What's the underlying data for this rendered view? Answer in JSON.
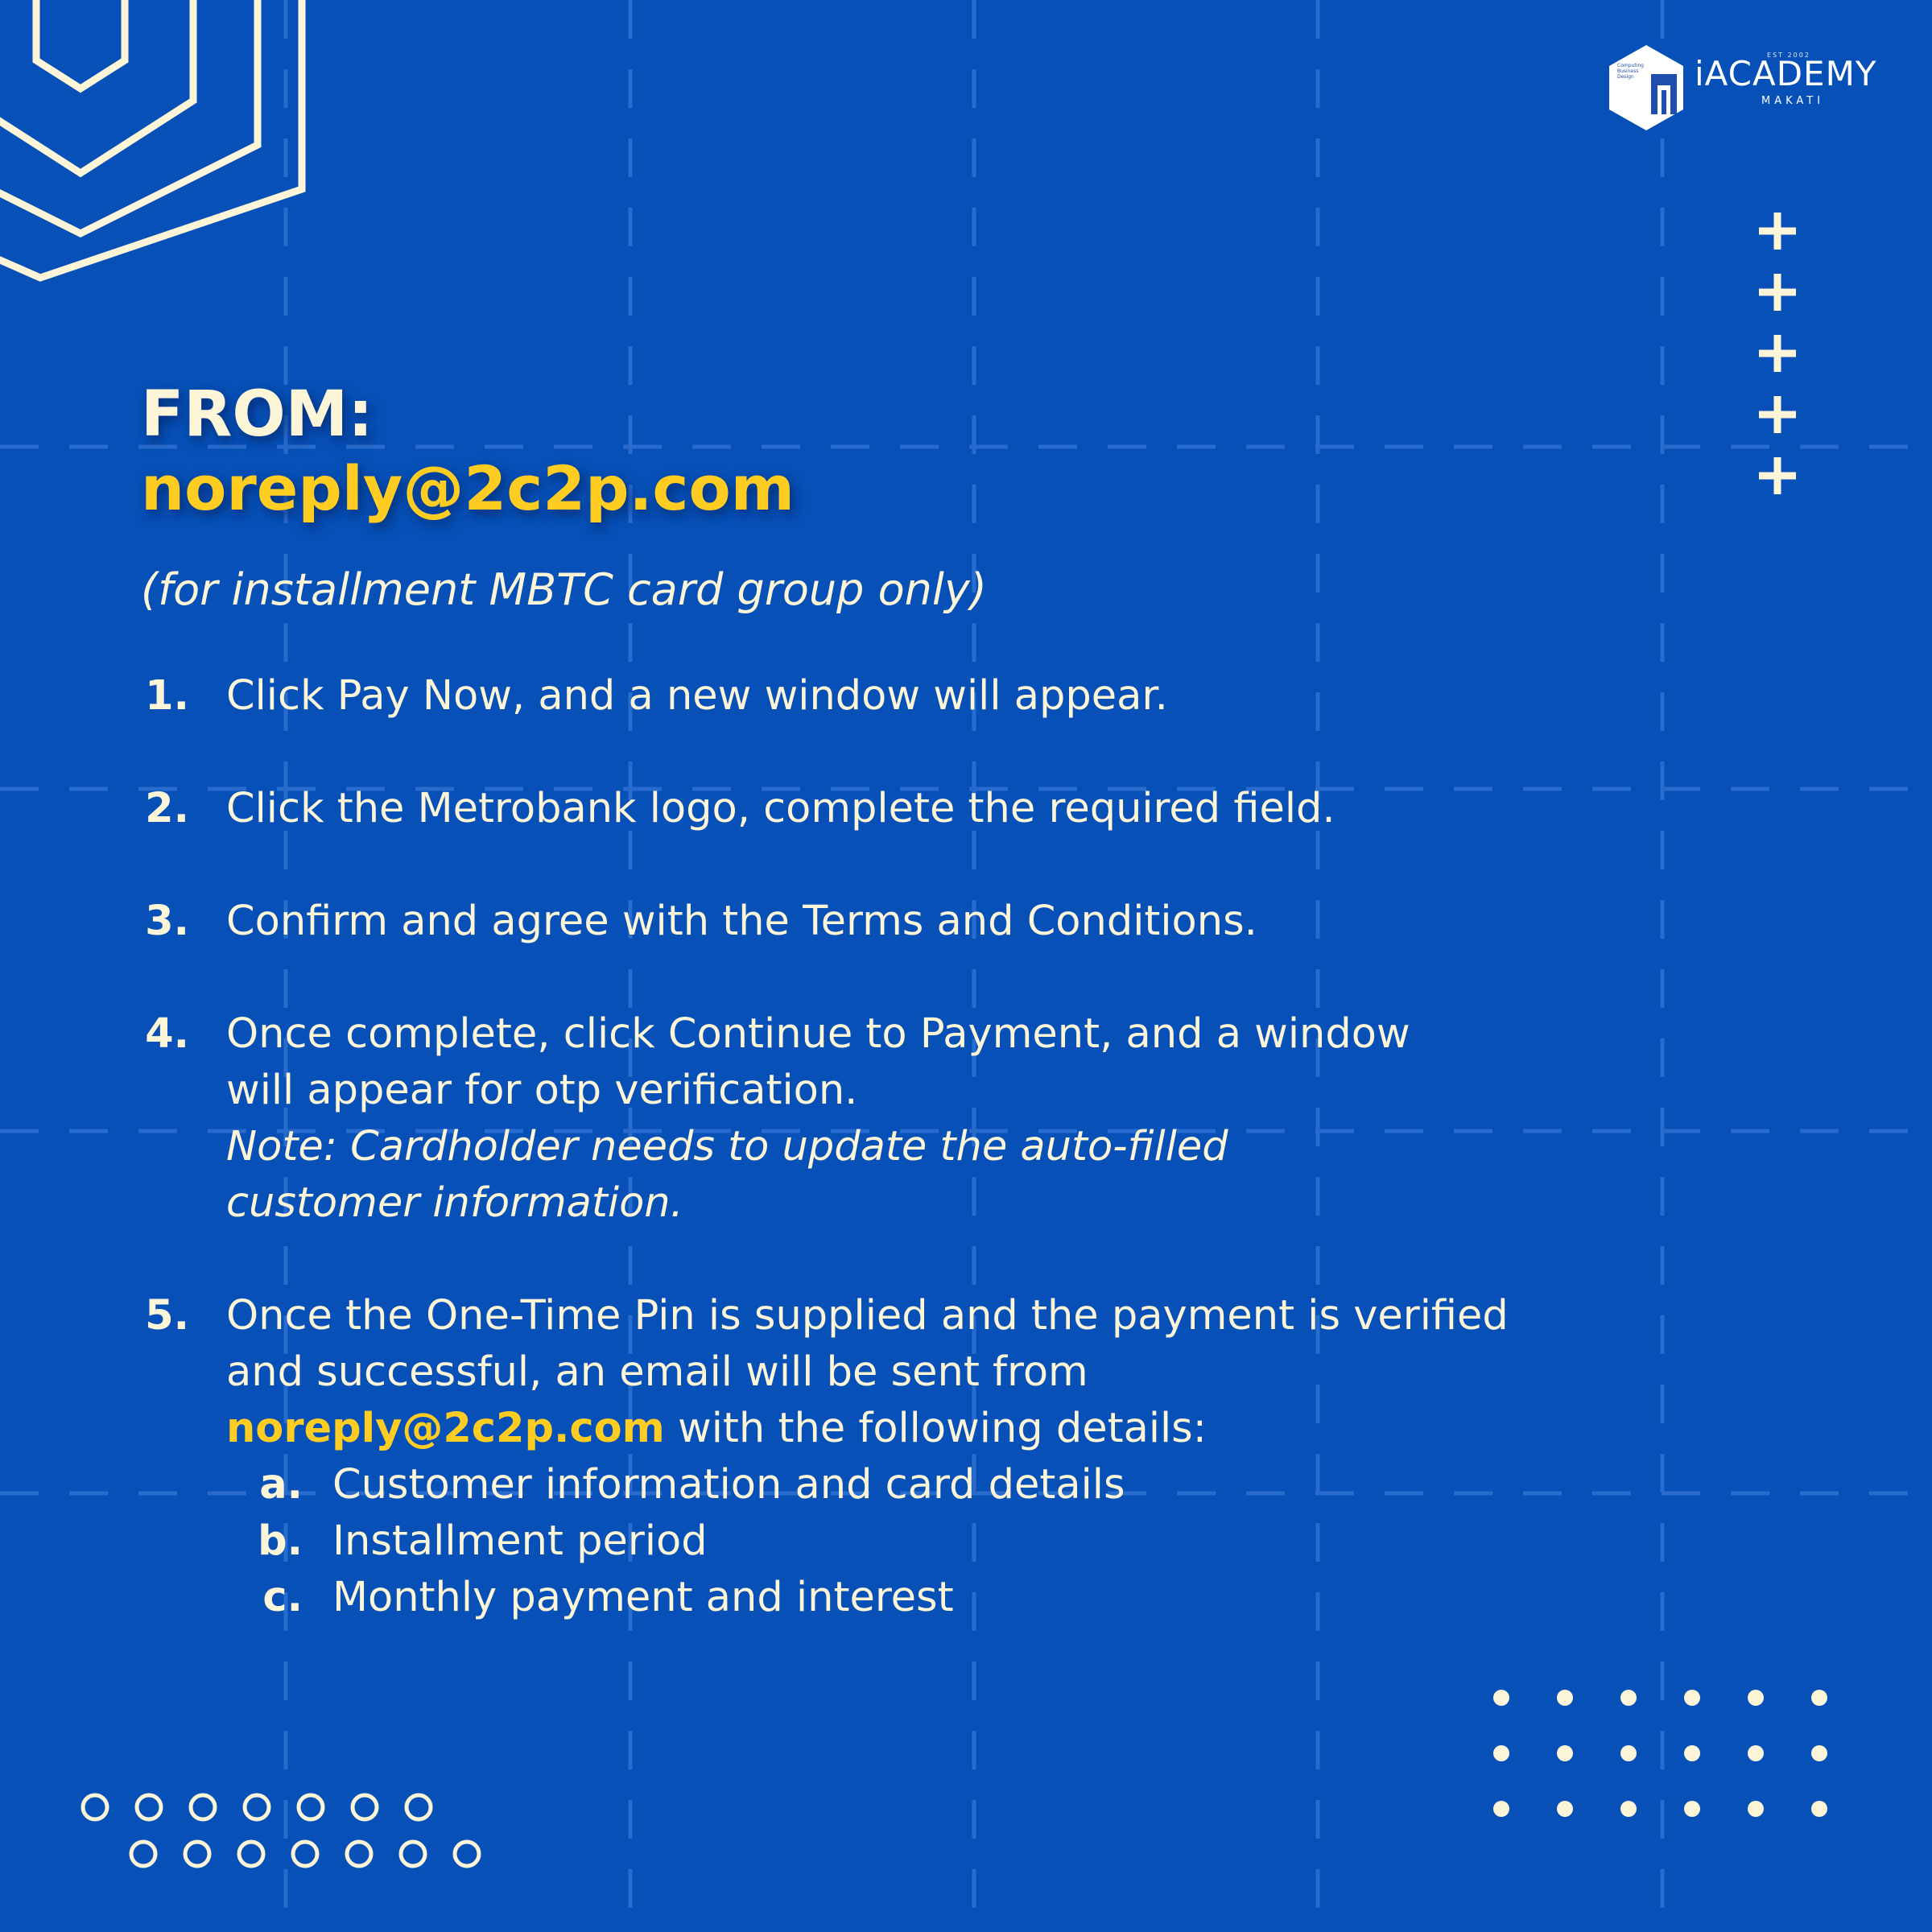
{
  "colors": {
    "background": "#0650b7",
    "accent_yellow": "#ffcc22",
    "cream": "#fdf5d7",
    "grid_line": "#2c6fd0"
  },
  "logo": {
    "est": "EST 2002",
    "mini_text": [
      "Computing",
      "Business",
      "Design"
    ],
    "wordmark": "iACADEMY",
    "subtitle": "MAKATI"
  },
  "header": {
    "from_label": "FROM:",
    "from_email": "noreply@2c2p.com",
    "subtitle": "(for installment MBTC card group only)"
  },
  "steps": [
    {
      "number": "1.",
      "lines": [
        "Click Pay Now, and a new window will appear."
      ]
    },
    {
      "number": "2.",
      "lines": [
        "Click the Metrobank logo, complete the required field."
      ]
    },
    {
      "number": "3.",
      "lines": [
        "Confirm and agree with the Terms and Conditions."
      ]
    },
    {
      "number": "4.",
      "lines": [
        "Once complete, click Continue to Payment, and a window",
        "will appear for otp verification."
      ],
      "note_lines": [
        "Note: Cardholder needs to update the auto-filled",
        "customer information."
      ]
    },
    {
      "number": "5.",
      "lines": [
        "Once the One-Time Pin is supplied and the payment is verified",
        "and successful, an email will be sent from"
      ],
      "email": "noreply@2c2p.com",
      "email_suffix": " with the following details:",
      "sub_items": [
        {
          "letter": "a.",
          "text": "Customer information and card details"
        },
        {
          "letter": "b.",
          "text": "Installment period"
        },
        {
          "letter": "c.",
          "text": "Monthly payment and interest"
        }
      ]
    }
  ]
}
